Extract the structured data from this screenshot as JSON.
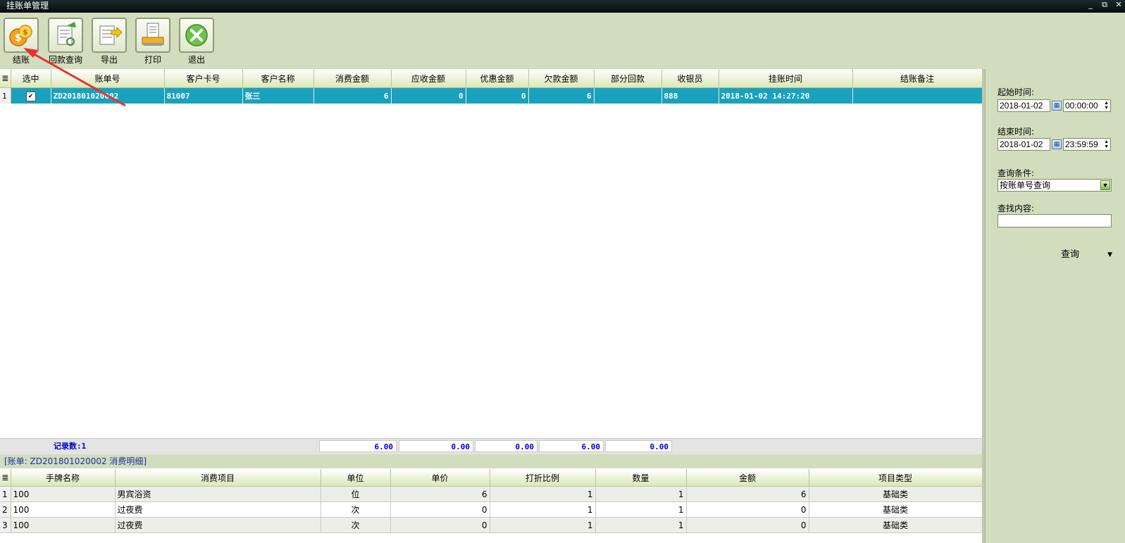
{
  "window": {
    "title": "挂账单管理",
    "controls": [
      "_",
      "⧉",
      "✕"
    ]
  },
  "toolbar": [
    {
      "label": "结账",
      "icon": "coins-icon"
    },
    {
      "label": "回款查询",
      "icon": "document-search-icon"
    },
    {
      "label": "导出",
      "icon": "export-icon"
    },
    {
      "label": "打印",
      "icon": "printer-icon"
    },
    {
      "label": "退出",
      "icon": "exit-icon"
    }
  ],
  "main_grid": {
    "columns": [
      "选中",
      "账单号",
      "客户卡号",
      "客户名称",
      "消费金额",
      "应收金额",
      "优惠金额",
      "欠款金额",
      "部分回款",
      "收银员",
      "挂账时间",
      "结账备注"
    ],
    "rows": [
      {
        "index": "1",
        "checked": "✔",
        "bill_no": "ZD201801020002",
        "card_no": "81007",
        "name": "张三",
        "consume": "6",
        "receivable": "0",
        "discount": "0",
        "owed": "6",
        "partial": "",
        "cashier": "888",
        "time": "2018-01-02 14:27:20",
        "remark": ""
      }
    ],
    "summary": {
      "record_count": "记录数:1",
      "consume": "6.00",
      "receivable": "0.00",
      "discount": "0.00",
      "owed": "6.00",
      "partial": "0.00"
    }
  },
  "detail": {
    "caption": "[账单: ZD201801020002 消费明细]",
    "columns": [
      "手牌名称",
      "消费项目",
      "单位",
      "单价",
      "打折比例",
      "数量",
      "金额",
      "项目类型"
    ],
    "rows": [
      {
        "index": "1",
        "tag": "100",
        "item": "男宾浴资",
        "unit": "位",
        "price": "6",
        "ratio": "1",
        "qty": "1",
        "amount": "6",
        "type": "基础类"
      },
      {
        "index": "2",
        "tag": "100",
        "item": "过夜费",
        "unit": "次",
        "price": "0",
        "ratio": "1",
        "qty": "1",
        "amount": "0",
        "type": "基础类"
      },
      {
        "index": "3",
        "tag": "100",
        "item": "过夜费",
        "unit": "次",
        "price": "0",
        "ratio": "1",
        "qty": "1",
        "amount": "0",
        "type": "基础类"
      }
    ]
  },
  "filters": {
    "start_label": "起始时间:",
    "start_date": "2018-01-02",
    "start_time": "00:00:00",
    "end_label": "结束时间:",
    "end_date": "2018-01-02",
    "end_time": "23:59:59",
    "condition_label": "查询条件:",
    "condition_value": "按账单号查询",
    "content_label": "查找内容:",
    "content_value": "",
    "query_button": "查询"
  },
  "colors": {
    "panel_bg": "#d2ddbd",
    "selected_row": "#1aa1bd",
    "summary_text": "#0000cc",
    "annotation_arrow": "#e8322e"
  }
}
